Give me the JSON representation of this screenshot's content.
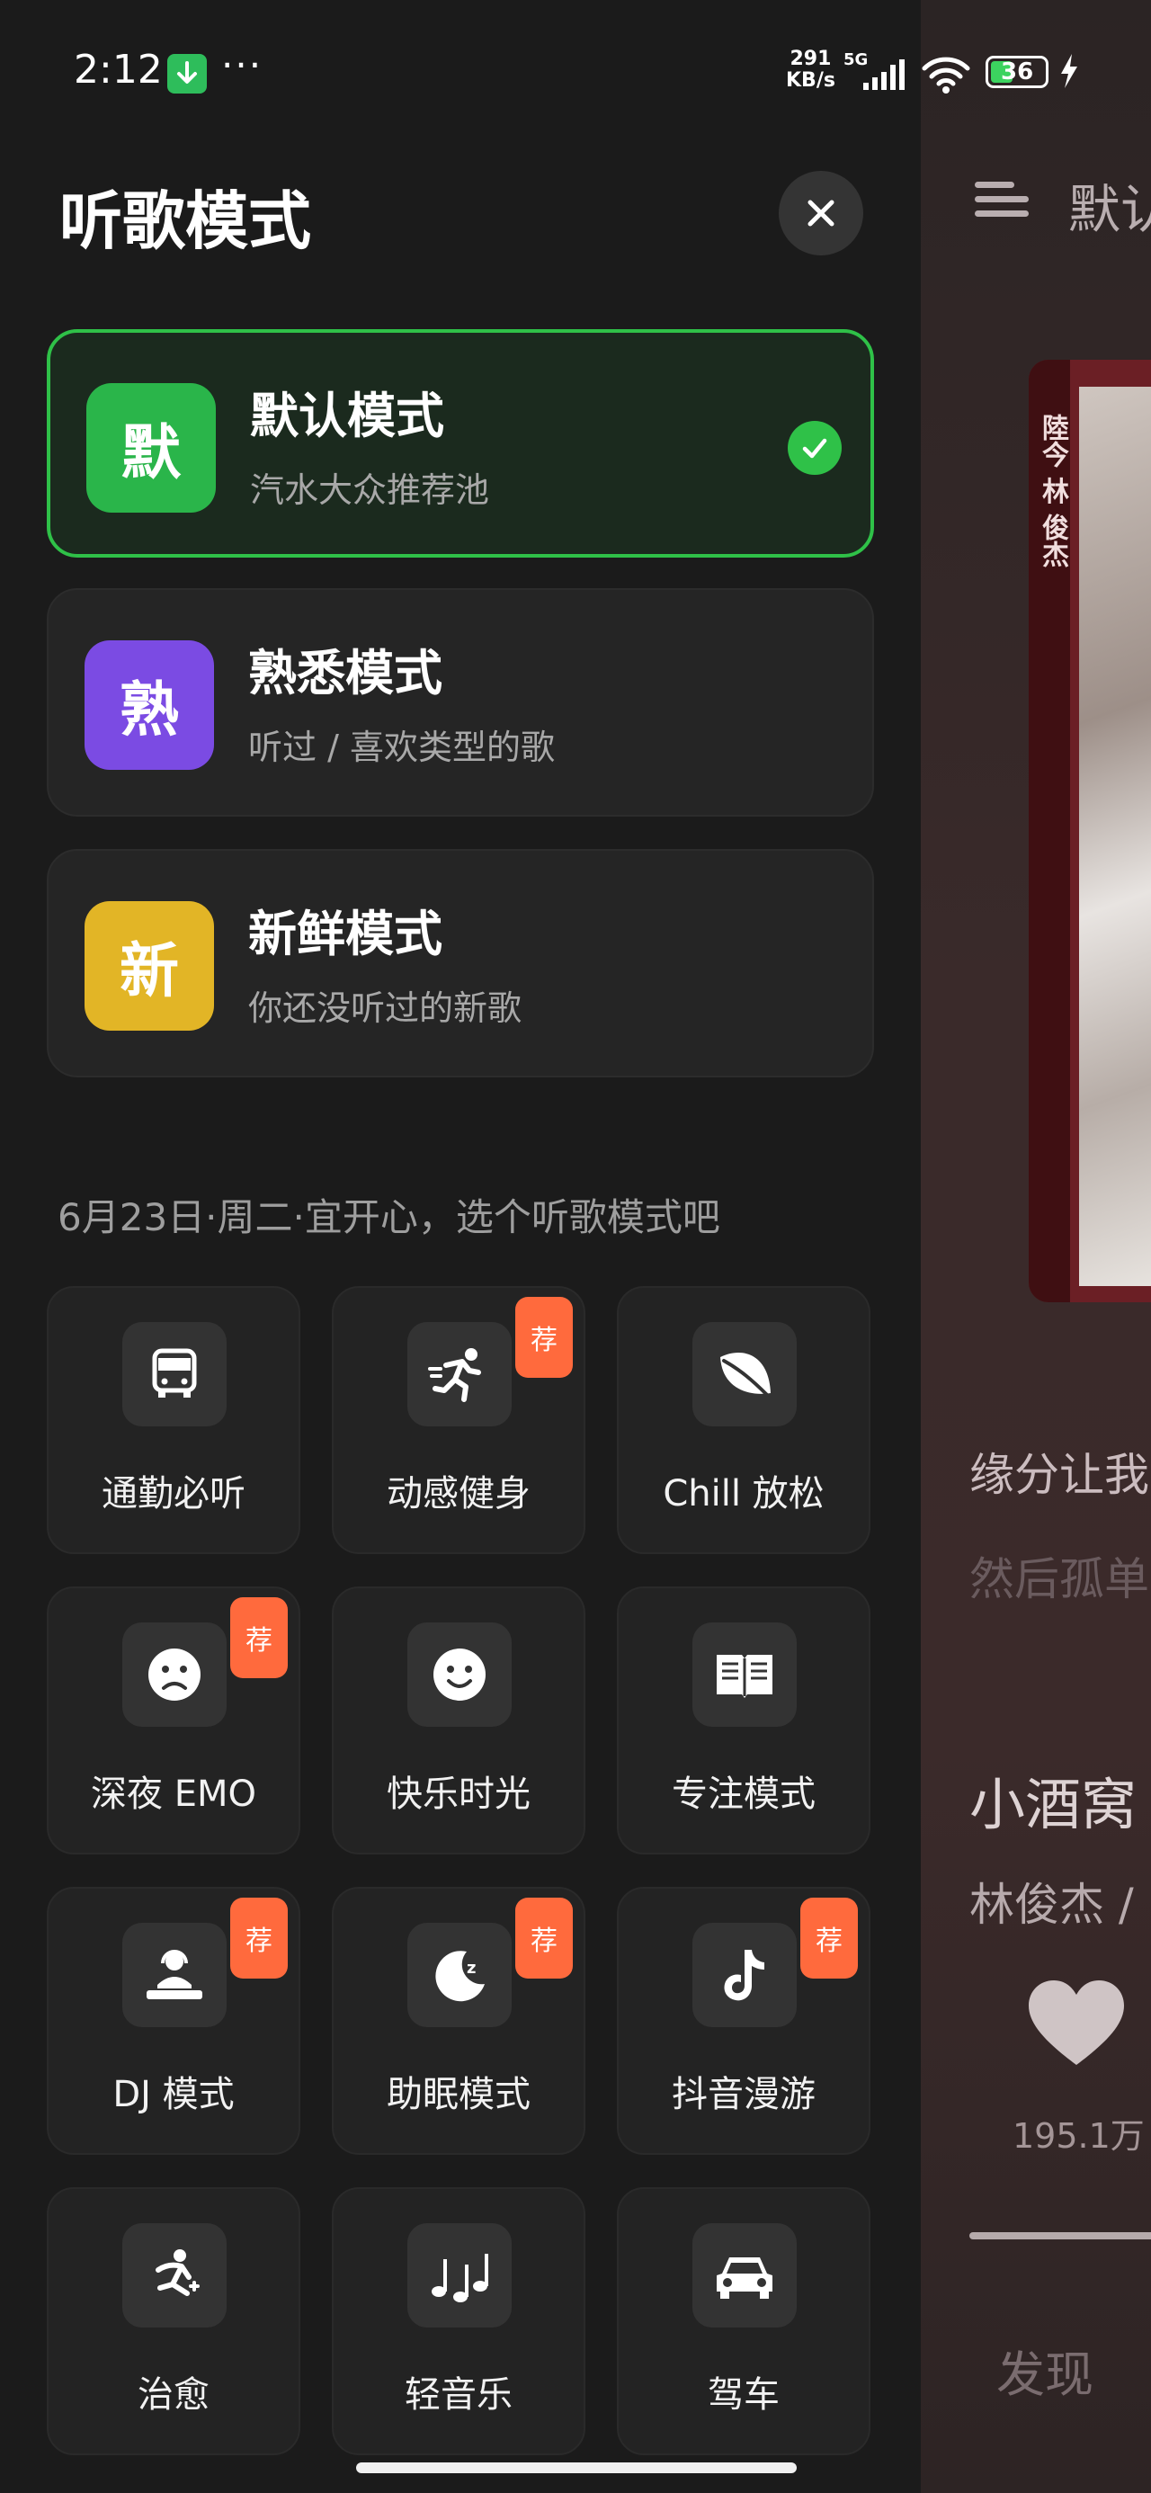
{
  "status_bar": {
    "time": "2:12",
    "more": "···",
    "speed_value": "291",
    "speed_unit": "KB/s",
    "network": "5G",
    "battery": "36",
    "icons": [
      "download-icon",
      "signal-icon",
      "wifi-icon",
      "battery-icon",
      "charging-icon"
    ]
  },
  "drawer": {
    "title": "听歌模式",
    "modes": [
      {
        "badge": "默",
        "name": "默认模式",
        "desc": "汽水大众推荐池",
        "color": "#2ab54a",
        "selected": true
      },
      {
        "badge": "熟",
        "name": "熟悉模式",
        "desc": "听过 / 喜欢类型的歌",
        "color": "#7b4be3",
        "selected": false
      },
      {
        "badge": "新",
        "name": "新鲜模式",
        "desc": "你还没听过的新歌",
        "color": "#e2b526",
        "selected": false
      }
    ],
    "date_line": "6月23日·周二·宜开心，选个听歌模式吧",
    "recommend_tag": "荐",
    "scenes": [
      {
        "label": "通勤必听",
        "icon": "bus-icon",
        "recommended": false
      },
      {
        "label": "动感健身",
        "icon": "running-icon",
        "recommended": true
      },
      {
        "label": "Chill 放松",
        "icon": "leaf-icon",
        "recommended": false
      },
      {
        "label": "深夜 EMO",
        "icon": "sad-face-icon",
        "recommended": true
      },
      {
        "label": "快乐时光",
        "icon": "happy-face-icon",
        "recommended": false
      },
      {
        "label": "专注模式",
        "icon": "book-icon",
        "recommended": false
      },
      {
        "label": "DJ 模式",
        "icon": "dj-icon",
        "recommended": true
      },
      {
        "label": "助眠模式",
        "icon": "moon-sleep-icon",
        "recommended": true
      },
      {
        "label": "抖音漫游",
        "icon": "tiktok-icon",
        "recommended": true
      },
      {
        "label": "治愈",
        "icon": "healing-icon",
        "recommended": false
      },
      {
        "label": "轻音乐",
        "icon": "music-notes-icon",
        "recommended": false
      },
      {
        "label": "驾车",
        "icon": "car-icon",
        "recommended": false
      }
    ]
  },
  "background_player": {
    "title_partial": "默认",
    "album_spine_text": "陸今 林 俊杰",
    "lyric_current": "缘分让我",
    "lyric_next": "然后孤单",
    "song_title": "小酒窝",
    "artist": "林俊杰 /",
    "like_count": "195.1万",
    "bottom_tab": "发现"
  },
  "colors": {
    "accent_green": "#2fc148",
    "recommend_orange": "#ff6a3d",
    "drawer_bg": "#1b1b1b"
  }
}
